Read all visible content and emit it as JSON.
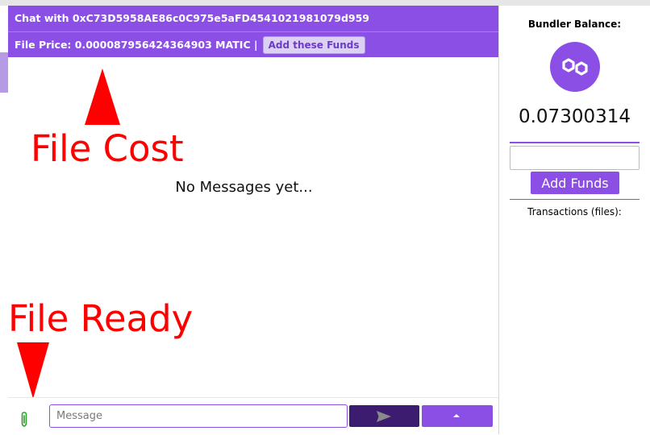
{
  "chat": {
    "title": "Chat with 0xC73D5958AE86c0C975e5aFD4541021981079d959",
    "file_price": "File Price: 0.000087956424364903 MATIC |",
    "add_funds_label": "Add these Funds",
    "empty_text": "No Messages yet...",
    "message_placeholder": "Message"
  },
  "annotations": {
    "file_cost": "File Cost",
    "file_ready": "File Ready"
  },
  "sidebar": {
    "title": "Bundler Balance:",
    "balance": "0.07300314",
    "add_funds_label": "Add Funds",
    "transactions_label": "Transactions (files):"
  },
  "icons": {
    "attachment": "paperclip-icon",
    "send": "send-icon",
    "expand": "caret-up-icon",
    "logo": "polygon-matic-icon"
  },
  "colors": {
    "accent": "#8b4fe6",
    "dark_accent": "#3b1c6e",
    "annotation": "#ff0000",
    "attachment": "#2e9b2e"
  }
}
